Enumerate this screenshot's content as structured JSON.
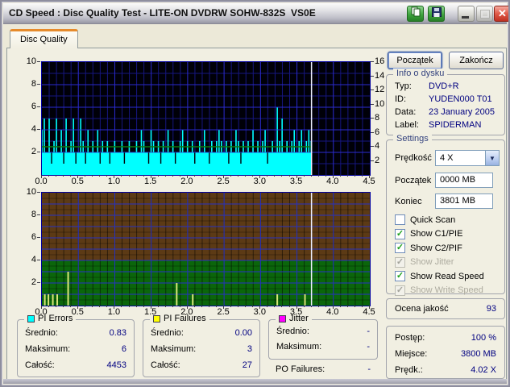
{
  "window": {
    "title": "CD Speed : Disc Quality Test - LITE-ON DVDRW SOHW-832S  VS0E"
  },
  "tab": {
    "label": "Disc Quality"
  },
  "controls": {
    "start_label": "Początek",
    "stop_label": "Zakończ"
  },
  "disc_info": {
    "title": "Info o dysku",
    "rows": [
      {
        "label": "Typ:",
        "value": "DVD+R"
      },
      {
        "label": "ID:",
        "value": "YUDEN000 T01"
      },
      {
        "label": "Data:",
        "value": "23 January 2005"
      },
      {
        "label": "Label:",
        "value": "SPIDERMAN"
      }
    ]
  },
  "settings": {
    "title": "Settings",
    "speed": {
      "label": "Prędkość",
      "value": "4 X"
    },
    "start": {
      "label": "Początek",
      "value": "0000 MB"
    },
    "end": {
      "label": "Koniec",
      "value": "3801 MB"
    },
    "checkboxes": [
      {
        "label": "Quick Scan",
        "checked": false,
        "enabled": true
      },
      {
        "label": "Show C1/PIE",
        "checked": true,
        "enabled": true
      },
      {
        "label": "Show C2/PIF",
        "checked": true,
        "enabled": true
      },
      {
        "label": "Show Jitter",
        "checked": true,
        "enabled": false
      },
      {
        "label": "Show Read Speed",
        "checked": true,
        "enabled": true
      },
      {
        "label": "Show Write Speed",
        "checked": true,
        "enabled": false
      }
    ]
  },
  "quality": {
    "label": "Ocena jakość",
    "value": "93"
  },
  "progress": {
    "rows": [
      {
        "label": "Postęp:",
        "value": "100 %"
      },
      {
        "label": "Miejsce:",
        "value": "3800 MB"
      },
      {
        "label": "Prędk.:",
        "value": "4.02 X"
      }
    ]
  },
  "panels": [
    {
      "title": "PI Errors",
      "color": "#00FFFF",
      "rows": [
        {
          "label": "Średnio:",
          "value": "0.83"
        },
        {
          "label": "Maksimum:",
          "value": "6"
        },
        {
          "label": "Całość:",
          "value": "4453"
        }
      ]
    },
    {
      "title": "PI Failures",
      "color": "#FFFF00",
      "rows": [
        {
          "label": "Średnio:",
          "value": "0.00"
        },
        {
          "label": "Maksimum:",
          "value": "3"
        },
        {
          "label": "Całość:",
          "value": "27"
        }
      ]
    },
    {
      "title": "Jitter",
      "color": "#FF00FF",
      "rows": [
        {
          "label": "Średnio:",
          "value": "-"
        },
        {
          "label": "Maksimum:",
          "value": "-"
        }
      ],
      "extra": {
        "label": "PO Failures:",
        "value": "-"
      }
    }
  ],
  "chart_data": [
    {
      "type": "area",
      "name": "pi-errors-and-read-speed",
      "x_unit": "GB",
      "xlim": [
        0,
        4.5
      ],
      "x_ticks": [
        "0.0",
        "0.5",
        "1.0",
        "1.5",
        "2.0",
        "2.5",
        "3.0",
        "3.5",
        "4.0",
        "4.5"
      ],
      "ylim_left": [
        0,
        10
      ],
      "y_ticks_left": [
        10,
        8,
        6,
        4,
        2
      ],
      "ylim_right": [
        0,
        16
      ],
      "y_ticks_right": [
        16,
        14,
        12,
        10,
        8,
        6,
        4,
        2
      ],
      "data_end_x": 3.7,
      "bg_color": "#000008",
      "grid_minor": "#16167F",
      "grid_major": "#2B2BD0",
      "series": [
        {
          "name": "PI Errors",
          "axis": "left",
          "color": "#00FFFF",
          "x_start": 0,
          "x_step": 0.0333,
          "values": [
            4,
            5,
            2,
            5,
            1,
            3,
            5,
            2,
            4,
            1,
            5,
            2,
            3,
            5,
            1,
            2,
            5,
            3,
            1,
            4,
            2,
            3,
            2,
            4,
            1,
            3,
            2,
            3,
            1,
            2,
            3,
            2,
            2,
            3,
            1,
            2,
            3,
            2,
            2,
            3,
            2,
            4,
            3,
            2,
            1,
            4,
            3,
            2,
            3,
            1,
            3,
            2,
            4,
            2,
            3,
            1,
            2,
            3,
            4,
            2,
            3,
            2,
            3,
            1,
            2,
            3,
            2,
            4,
            2,
            1,
            3,
            2,
            3,
            4,
            3,
            2,
            3,
            1,
            3,
            2,
            4,
            3,
            1,
            3,
            2,
            3,
            2,
            4,
            2,
            3,
            2,
            3,
            4,
            1,
            2,
            3,
            2,
            6,
            3,
            5,
            2,
            3,
            2,
            3,
            4,
            2,
            3,
            4,
            2,
            3,
            4,
            3
          ]
        },
        {
          "name": "Read Speed",
          "axis": "right",
          "color": "#0C7A0C",
          "constant_value": 4,
          "x_end": 3.7
        }
      ],
      "end_marker": {
        "x": 3.7,
        "color": "#EEF0FF"
      }
    },
    {
      "type": "bar",
      "name": "pi-failures",
      "x_unit": "GB",
      "xlim": [
        0,
        4.5
      ],
      "x_ticks": [
        "0.0",
        "0.5",
        "1.0",
        "1.5",
        "2.0",
        "2.5",
        "3.0",
        "3.5",
        "4.0",
        "4.5"
      ],
      "ylim": [
        0,
        10
      ],
      "y_ticks": [
        10,
        8,
        6,
        4,
        2
      ],
      "zones": [
        {
          "from": 0,
          "to": 4,
          "color": "#0B660B"
        },
        {
          "from": 4,
          "to": 10,
          "color": "#5C3A15"
        }
      ],
      "grid_blue": "#2733C4",
      "bar_color": "#D8E678",
      "bars": [
        [
          0.04,
          1
        ],
        [
          0.09,
          1
        ],
        [
          0.15,
          1
        ],
        [
          0.21,
          1
        ],
        [
          0.36,
          3
        ],
        [
          1.85,
          2
        ],
        [
          2.07,
          1
        ],
        [
          3.23,
          1
        ],
        [
          3.61,
          1
        ]
      ],
      "end_marker": {
        "x": 3.7,
        "color": "#EEF0FF"
      }
    }
  ]
}
